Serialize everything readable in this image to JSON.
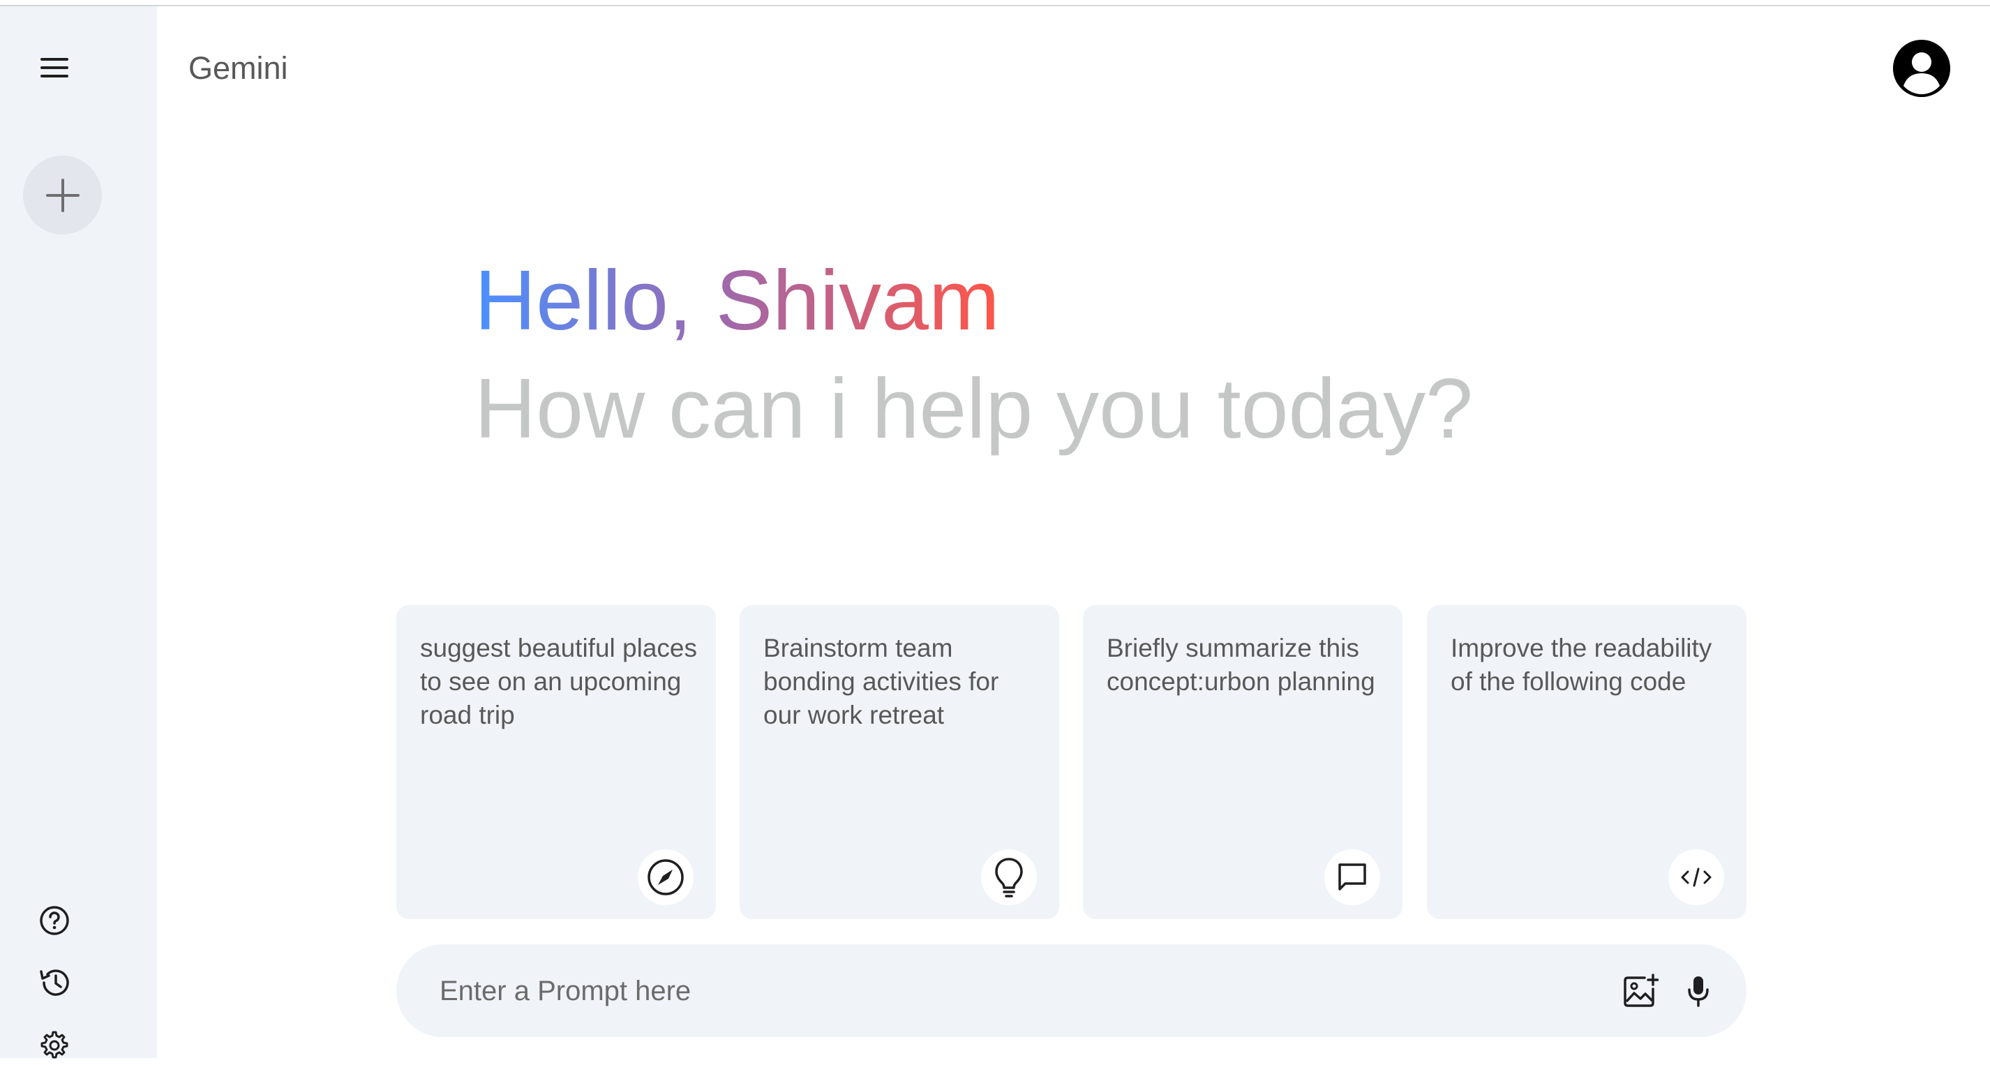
{
  "app": {
    "title": "Gemini"
  },
  "sidebar": {
    "menu_icon": "menu-icon",
    "new_chat_icon": "plus-icon",
    "bottom_icons": [
      "help-icon",
      "history-icon",
      "gear-icon"
    ]
  },
  "greeting": {
    "hello": "Hello, Shivam",
    "subtitle": "How can i help you today?"
  },
  "cards": [
    {
      "text": "suggest beautiful places to see on an upcoming road trip",
      "icon": "compass-icon"
    },
    {
      "text": "Brainstorm team bonding activities for our work retreat",
      "icon": "bulb-icon"
    },
    {
      "text": "Briefly summarize this concept:urbon planning",
      "icon": "message-icon"
    },
    {
      "text": "Improve the readability of the following code",
      "icon": "code-icon"
    }
  ],
  "prompt": {
    "placeholder": "Enter a Prompt here"
  },
  "colors": {
    "sidebar_bg": "#f0f4f9",
    "card_bg": "#f0f4f9",
    "gradient_start": "#4b90ff",
    "gradient_end": "#ff5546",
    "subtitle": "#c4c7c5"
  }
}
